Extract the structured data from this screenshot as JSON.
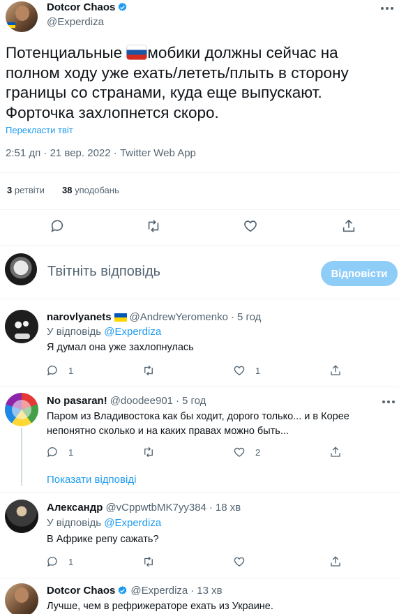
{
  "main_tweet": {
    "author_name": "Dotcor Chaos",
    "author_handle": "@Experdiza",
    "text_before_flag": "Потенциальные",
    "text_after_flag": "мобики должны сейчас на полном ходу уже ехать/лететь/плыть  в сторону границы со странами, куда еще выпускают. Форточка захлопнется скоро.",
    "translate_link": "Перекласти твіт",
    "meta": "2:51 дп · 21 вер. 2022 · Twitter Web App",
    "retweets_count": "3",
    "retweets_label": "ретвіти",
    "likes_count": "38",
    "likes_label": "уподобань"
  },
  "compose": {
    "placeholder": "Твітніть відповідь",
    "button": "Відповісти"
  },
  "replies": [
    {
      "name": "narovlyanets",
      "handle": "@AndrewYeromenko",
      "time": "5 год",
      "replying_prefix": "У відповідь",
      "replying_to": "@Experdiza",
      "text": "Я думал она уже захлопнулась",
      "reply_count": "1",
      "retweet_count": "",
      "like_count": "1"
    },
    {
      "name": "No pasaran!",
      "handle": "@doodee901",
      "time": "5 год",
      "text": "Паром из Владивостока как бы ходит, дорого только... и в Корее непонятно сколько и на каких правах можно быть...",
      "reply_count": "1",
      "retweet_count": "",
      "like_count": "2",
      "show_replies": "Показати відповіді"
    },
    {
      "name": "Александр",
      "handle": "@vCppwtbMK7yy384",
      "time": "18 хв",
      "replying_prefix": "У відповідь",
      "replying_to": "@Experdiza",
      "text": "В Африке репу сажать?",
      "reply_count": "1",
      "retweet_count": "",
      "like_count": ""
    },
    {
      "name": "Dotcor Chaos",
      "handle": "@Experdiza",
      "time": "13 хв",
      "text": "Лучше, чем в рефрижераторе ехать из Украине."
    }
  ],
  "colors": {
    "accent": "#1d9bf0",
    "muted": "#536471",
    "divider": "#eff3f4",
    "button_disabled": "#8ecdf8"
  },
  "icons": [
    "more-icon",
    "verified-badge-icon",
    "reply-icon",
    "retweet-icon",
    "like-icon",
    "share-icon",
    "ru-flag-icon",
    "ua-flag-icon"
  ]
}
